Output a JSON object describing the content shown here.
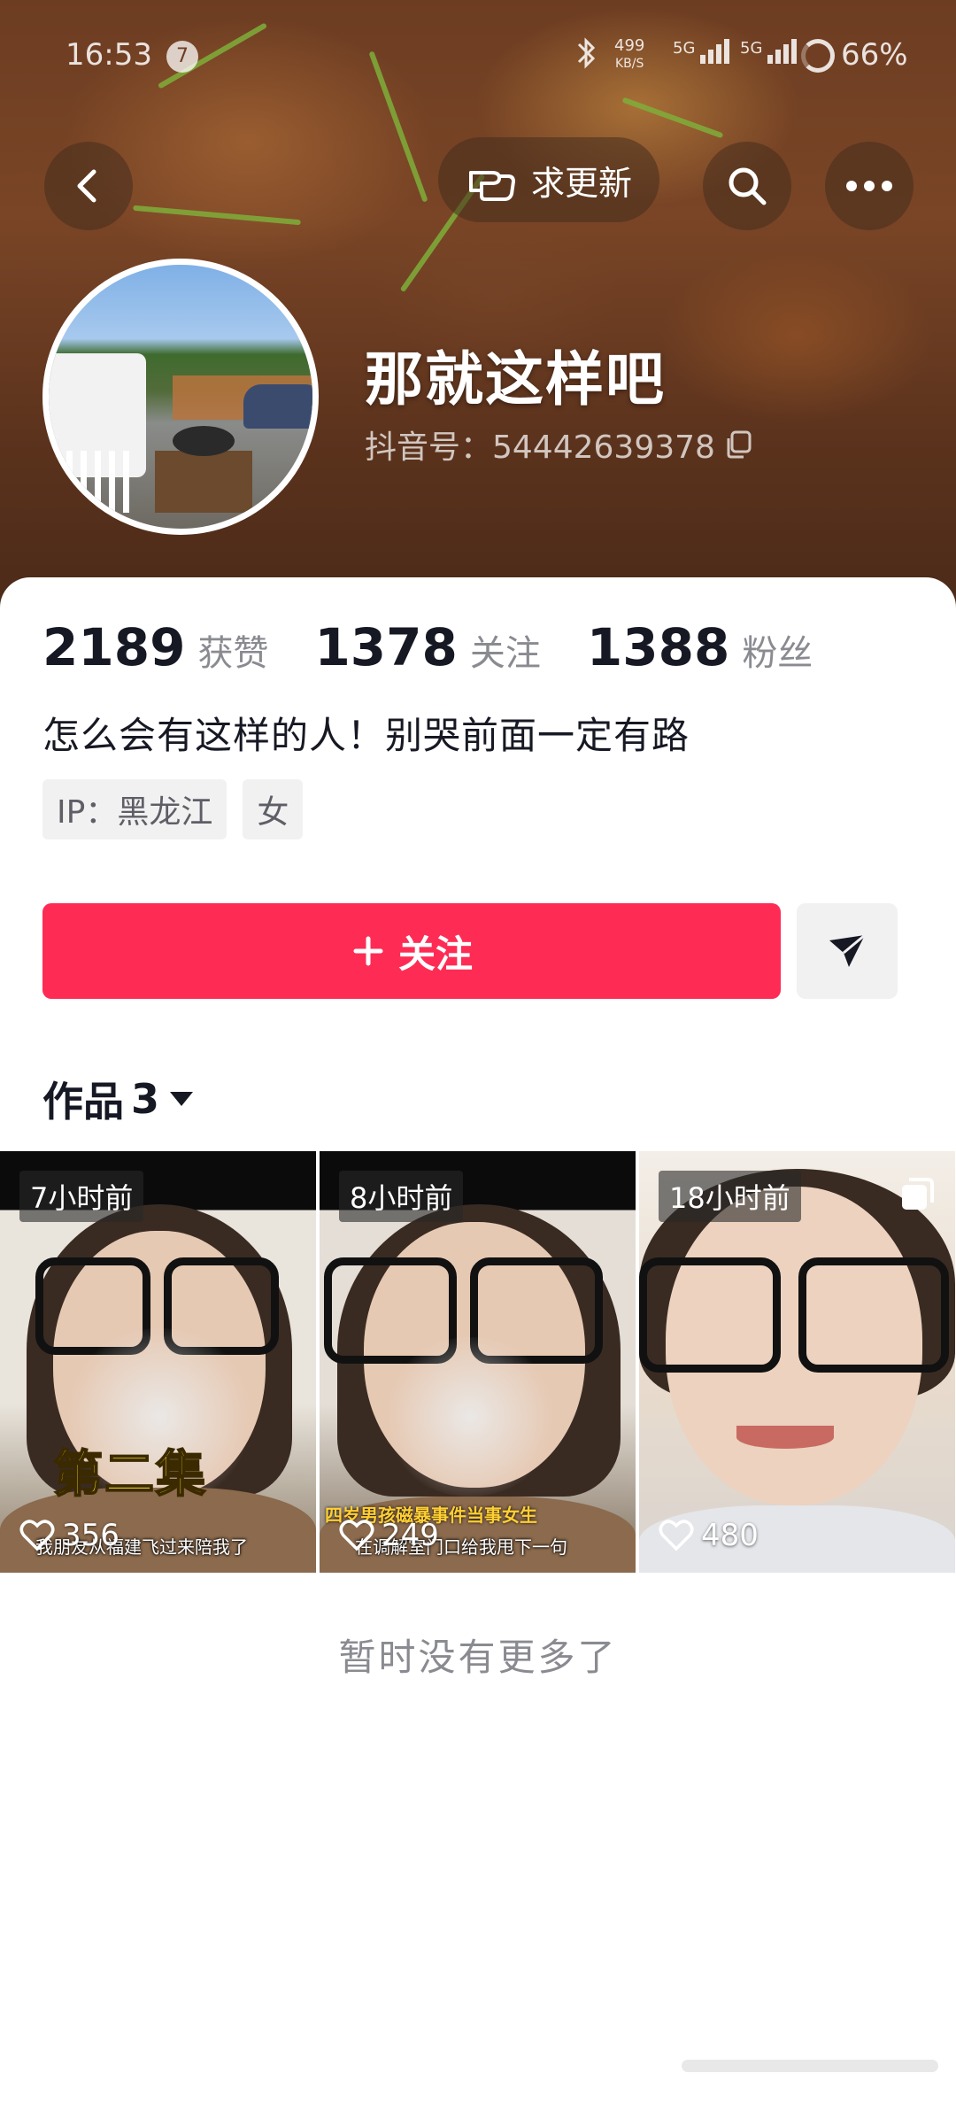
{
  "status_bar": {
    "time": "16:53",
    "notification_count": "7",
    "net_speed": "499",
    "net_speed_unit": "KB/S",
    "signal1": "5G",
    "signal2": "5G",
    "battery": "66%"
  },
  "header": {
    "request_update_label": "求更新",
    "icons": [
      "back-icon",
      "hand-pointer-icon",
      "search-icon",
      "more-icon"
    ]
  },
  "profile": {
    "nickname": "那就这样吧",
    "douyin_id": "抖音号：54442639378",
    "likes_count": "2189",
    "likes_label": "获赞",
    "following_count": "1378",
    "following_label": "关注",
    "followers_count": "1388",
    "followers_label": "粉丝",
    "bio": "怎么会有这样的人！别哭前面一定有路",
    "tags": [
      "IP：黑龙江",
      "女"
    ]
  },
  "actions": {
    "follow_label": "关注",
    "accent_color": "#fe2c55"
  },
  "works": {
    "label": "作品",
    "count": "3",
    "videos": [
      {
        "time": "7小时前",
        "overlay_title": "第二集",
        "caption": "我朋友从福建飞过来陪我了",
        "likes": "356"
      },
      {
        "time": "8小时前",
        "caption_top": "四岁男孩磁暴事件当事女生",
        "caption": "在调解室门口给我甩下一句",
        "likes": "249"
      },
      {
        "time": "18小时前",
        "likes": "480"
      }
    ],
    "no_more_text": "暂时没有更多了"
  }
}
